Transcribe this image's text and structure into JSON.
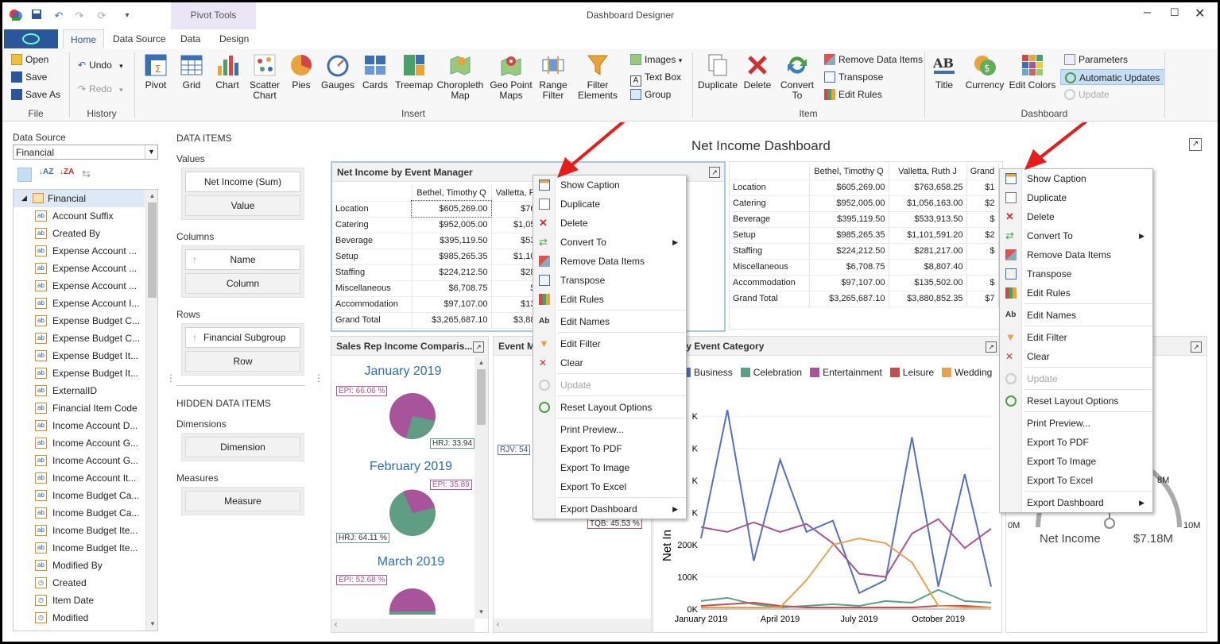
{
  "window": {
    "title": "Dashboard Designer",
    "context_tab_group": "Pivot Tools"
  },
  "tabs": [
    "Home",
    "Data Source",
    "Data",
    "Design"
  ],
  "ribbon": {
    "file": {
      "group": "File",
      "open": "Open",
      "save": "Save",
      "save_as": "Save As"
    },
    "history": {
      "group": "History",
      "undo": "Undo",
      "redo": "Redo"
    },
    "insert": {
      "group": "Insert",
      "pivot": "Pivot",
      "grid": "Grid",
      "chart": "Chart",
      "scatter": "Scatter Chart",
      "pies": "Pies",
      "gauges": "Gauges",
      "cards": "Cards",
      "treemap": "Treemap",
      "choropleth": "Choropleth Map",
      "geopoint": "Geo Point Maps",
      "range": "Range Filter",
      "filter": "Filter Elements",
      "images": "Images",
      "textbox": "Text Box",
      "group_btn": "Group"
    },
    "item": {
      "group": "Item",
      "duplicate": "Duplicate",
      "delete": "Delete",
      "convert": "Convert To",
      "remove": "Remove Data Items",
      "transpose": "Transpose",
      "edit_rules": "Edit Rules"
    },
    "dashboard": {
      "group": "Dashboard",
      "title": "Title",
      "currency": "Currency",
      "edit_colors": "Edit Colors",
      "parameters": "Parameters",
      "auto_updates": "Automatic Updates",
      "update": "Update"
    }
  },
  "datasource": {
    "label": "Data Source",
    "selected": "Financial",
    "root": "Financial",
    "fields": [
      {
        "name": "Account Suffix",
        "kind": "ab"
      },
      {
        "name": "Created By",
        "kind": "ab"
      },
      {
        "name": "Expense Account ...",
        "kind": "ab"
      },
      {
        "name": "Expense Account ...",
        "kind": "ab"
      },
      {
        "name": "Expense Account ...",
        "kind": "ab"
      },
      {
        "name": "Expense Account I...",
        "kind": "ab"
      },
      {
        "name": "Expense Budget C...",
        "kind": "ab"
      },
      {
        "name": "Expense Budget C...",
        "kind": "ab"
      },
      {
        "name": "Expense Budget It...",
        "kind": "ab"
      },
      {
        "name": "Expense Budget It...",
        "kind": "ab"
      },
      {
        "name": "ExternalID",
        "kind": "ab"
      },
      {
        "name": "Financial Item Code",
        "kind": "ab"
      },
      {
        "name": "Income Account D...",
        "kind": "ab"
      },
      {
        "name": "Income Account G...",
        "kind": "ab"
      },
      {
        "name": "Income Account G...",
        "kind": "ab"
      },
      {
        "name": "Income Account It...",
        "kind": "ab"
      },
      {
        "name": "Income Budget Ca...",
        "kind": "ab"
      },
      {
        "name": "Income Budget Ca...",
        "kind": "ab"
      },
      {
        "name": "Income Budget Ite...",
        "kind": "ab"
      },
      {
        "name": "Income Budget Ite...",
        "kind": "ab"
      },
      {
        "name": "Modified By",
        "kind": "ab"
      },
      {
        "name": "Created",
        "kind": "clock"
      },
      {
        "name": "Item Date",
        "kind": "clock"
      },
      {
        "name": "Modified",
        "kind": "clock"
      }
    ]
  },
  "dataitems": {
    "heading": "DATA ITEMS",
    "values_label": "Values",
    "values_item": "Net Income (Sum)",
    "values_slot": "Value",
    "columns_label": "Columns",
    "columns_item": "Name",
    "columns_slot": "Column",
    "rows_label": "Rows",
    "rows_item": "Financial Subgroup T...",
    "rows_slot": "Row",
    "hidden_heading": "HIDDEN DATA ITEMS",
    "dimensions_label": "Dimensions",
    "dimensions_slot": "Dimension",
    "measures_label": "Measures",
    "measures_slot": "Measure"
  },
  "dashboard_title": "Net Income Dashboard",
  "pivot": {
    "caption": "Net Income by Event Manager",
    "columns": [
      "Bethel, Timothy Q",
      "Valletta, Ruth J",
      "Grand"
    ],
    "rows": [
      {
        "label": "Location",
        "values": [
          "$605,269.00",
          "$763,658.25",
          "$1"
        ]
      },
      {
        "label": "Catering",
        "values": [
          "$952,005.00",
          "$1,056,163.00",
          "$2"
        ]
      },
      {
        "label": "Beverage",
        "values": [
          "$395,119.50",
          "$533,913.50",
          "$"
        ]
      },
      {
        "label": "Setup",
        "values": [
          "$985,265.35",
          "$1,101,591.20",
          "$2"
        ]
      },
      {
        "label": "Staffing",
        "values": [
          "$224,212.50",
          "$281,217.00",
          "$"
        ]
      },
      {
        "label": "Miscellaneous",
        "values": [
          "$6,708.75",
          "$8,807.40",
          ""
        ]
      },
      {
        "label": "Accommodation",
        "values": [
          "$97,107.00",
          "$135,502.00",
          "$"
        ]
      },
      {
        "label": "Grand Total",
        "values": [
          "$3,265,687.10",
          "$3,880,852.35",
          "$7"
        ]
      }
    ],
    "selected_cols_short": [
      "Valletta, F",
      "$76",
      "$1,05",
      "$53",
      "$1,10",
      "$28",
      "$",
      "$13",
      "$3,88"
    ]
  },
  "pies": {
    "caption": "Sales Rep Income Comparis...",
    "months": [
      {
        "title": "January 2019",
        "a": "EPI: 66.06 %",
        "b": "HRJ: 33.94"
      },
      {
        "title": "February 2019",
        "a": "EPI: 35.89",
        "b": "HRJ: 64.11 %"
      },
      {
        "title": "March 2019",
        "a": "EPI: 52.68 %",
        "b": ""
      }
    ],
    "color_a": "#a8549b",
    "color_b": "#5f9e84"
  },
  "event_panel": {
    "caption": "Event M",
    "label_a": "RJV: 54",
    "label_b": "TQB: 45.53 %"
  },
  "linechart": {
    "caption": "e by Event Category",
    "ylabel": "Net In",
    "legend": [
      {
        "name": "Business",
        "color": "#5470c6"
      },
      {
        "name": "Celebration",
        "color": "#5aa088"
      },
      {
        "name": "Entertainment",
        "color": "#a8549b"
      },
      {
        "name": "Leisure",
        "color": "#c0504d"
      },
      {
        "name": "Wedding",
        "color": "#e6a24e"
      }
    ]
  },
  "chart_data": {
    "type": "line",
    "xlabel": "",
    "ylabel": "Net In",
    "x": [
      "Jan 2019",
      "Feb 2019",
      "Mar 2019",
      "Apr 2019",
      "May 2019",
      "Jun 2019",
      "Jul 2019",
      "Aug 2019",
      "Sep 2019",
      "Oct 2019",
      "Nov 2019",
      "Dec 2019"
    ],
    "x_ticks": [
      "January 2019",
      "April 2019",
      "July 2019",
      "October 2019"
    ],
    "y_ticks": [
      "0K",
      "100K",
      "200K",
      "K",
      "K",
      "K",
      "K"
    ],
    "ylim": [
      0,
      650000
    ],
    "series": [
      {
        "name": "Business",
        "values": [
          220000,
          620000,
          150000,
          465000,
          240000,
          275000,
          50000,
          90000,
          535000,
          70000,
          420000,
          70000
        ]
      },
      {
        "name": "Celebration",
        "values": [
          25000,
          35000,
          15000,
          5000,
          10000,
          15000,
          10000,
          25000,
          20000,
          60000,
          25000,
          20000
        ]
      },
      {
        "name": "Entertainment",
        "values": [
          255000,
          240000,
          270000,
          240000,
          265000,
          205000,
          110000,
          100000,
          235000,
          280000,
          190000,
          250000
        ]
      },
      {
        "name": "Leisure",
        "values": [
          10000,
          15000,
          20000,
          10000,
          5000,
          5000,
          5000,
          5000,
          5000,
          10000,
          10000,
          5000
        ]
      },
      {
        "name": "Wedding",
        "values": [
          5000,
          5000,
          5000,
          5000,
          90000,
          200000,
          220000,
          205000,
          145000,
          10000,
          5000,
          5000
        ]
      }
    ]
  },
  "gauge": {
    "min": "0M",
    "max": "10M",
    "mark": "8M",
    "label": "Net Income",
    "value": "$7.18M"
  },
  "context_menu": [
    {
      "label": "Show Caption",
      "icon": "caption",
      "disabled": false,
      "sub": false,
      "sep_after": false,
      "highlight": true
    },
    {
      "label": "Duplicate",
      "icon": "duplicate",
      "disabled": false,
      "sub": false,
      "sep_after": false
    },
    {
      "label": "Delete",
      "icon": "delete",
      "disabled": false,
      "sub": false,
      "sep_after": false
    },
    {
      "label": "Convert To",
      "icon": "convert",
      "disabled": false,
      "sub": true,
      "sep_after": false
    },
    {
      "label": "Remove Data Items",
      "icon": "eraser",
      "disabled": false,
      "sub": false,
      "sep_after": false
    },
    {
      "label": "Transpose",
      "icon": "transpose",
      "disabled": false,
      "sub": false,
      "sep_after": false
    },
    {
      "label": "Edit Rules",
      "icon": "rules",
      "disabled": false,
      "sub": false,
      "sep_after": true
    },
    {
      "label": "Edit Names",
      "icon": "names",
      "disabled": false,
      "sub": false,
      "sep_after": true
    },
    {
      "label": "Edit Filter",
      "icon": "filter",
      "disabled": false,
      "sub": false,
      "sep_after": false
    },
    {
      "label": "Clear",
      "icon": "clear",
      "disabled": false,
      "sub": false,
      "sep_after": true
    },
    {
      "label": "Update",
      "icon": "update",
      "disabled": true,
      "sub": false,
      "sep_after": true
    },
    {
      "label": "Reset Layout Options",
      "icon": "reset",
      "disabled": false,
      "sub": false,
      "sep_after": true
    },
    {
      "label": "Print Preview...",
      "icon": "",
      "disabled": false,
      "sub": false,
      "sep_after": false
    },
    {
      "label": "Export To PDF",
      "icon": "",
      "disabled": false,
      "sub": false,
      "sep_after": false
    },
    {
      "label": "Export To Image",
      "icon": "",
      "disabled": false,
      "sub": false,
      "sep_after": false
    },
    {
      "label": "Export To Excel",
      "icon": "",
      "disabled": false,
      "sub": false,
      "sep_after": true
    },
    {
      "label": "Export Dashboard",
      "icon": "",
      "disabled": false,
      "sub": true,
      "sep_after": false
    }
  ],
  "colors": {
    "accent": "#2b579a",
    "arrow": "#e81b1b",
    "auto_updates_bg": "#c5def5"
  }
}
